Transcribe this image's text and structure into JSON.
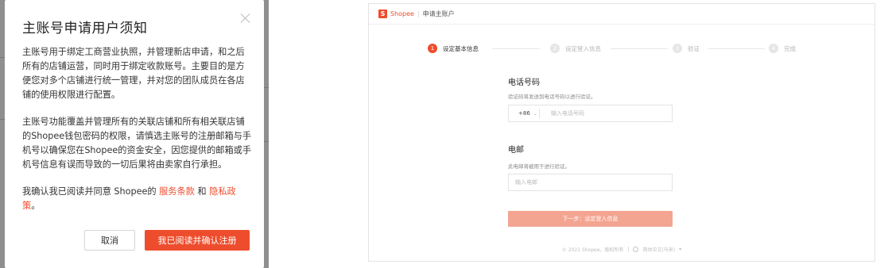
{
  "modal": {
    "title": "主账号申请用户须知",
    "paragraph1": "主账号用于绑定工商营业执照，并管理新店申请，和之后所有的店铺运营，同时用于绑定收款账号。主要目的是方便您对多个店铺进行统一管理，并对您的团队成员在各店铺的使用权限进行配置。",
    "paragraph2": "主账号功能覆盖并管理所有的关联店铺和所有相关联店铺的Shopee钱包密码的权限，请慎选主账号的注册邮箱与手机号以确保您在Shopee的资金安全，因您提供的邮箱或手机号信息有误而导致的一切后果将由卖家自行承担。",
    "agreement_prefix": "我确认我已阅读并同意 Shopee的 ",
    "terms_link": "服务条款",
    "and_text": " 和 ",
    "privacy_link": "隐私政策",
    "agreement_suffix": "。",
    "cancel_label": "取消",
    "confirm_label": "我已阅读并确认注册"
  },
  "page": {
    "logo_text": "Shopee",
    "logo_letter": "S",
    "separator": "|",
    "page_title": "申请主账户",
    "steps": [
      {
        "number": "1",
        "label": "设定基本信息",
        "active": true
      },
      {
        "number": "2",
        "label": "设定登入信息",
        "active": false
      },
      {
        "number": "3",
        "label": "验证",
        "active": false
      },
      {
        "number": "4",
        "label": "完成",
        "active": false
      }
    ],
    "phone_section": {
      "title": "电话号码",
      "hint": "验证码将发送到电话号码以进行验证。",
      "country_code": "+86",
      "placeholder": "输入电话号码"
    },
    "email_section": {
      "title": "电邮",
      "hint": "此电邮将被用于进行验证。",
      "placeholder": "输入电邮"
    },
    "next_button": "下一步：设定登入信息",
    "footer": {
      "copyright": "© 2021 Shopee。版权所有",
      "divider": "|",
      "language": "简体中文(马来)"
    }
  },
  "colors": {
    "brand": "#ee4d2d",
    "next_button_disabled": "#f3a592"
  }
}
